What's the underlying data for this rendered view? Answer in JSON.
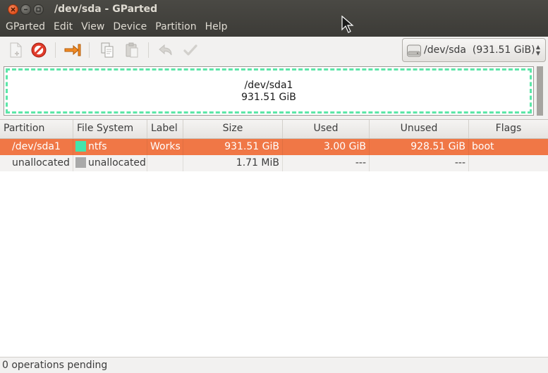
{
  "window": {
    "title": "/dev/sda - GParted"
  },
  "menubar": {
    "items": [
      "GParted",
      "Edit",
      "View",
      "Device",
      "Partition",
      "Help"
    ]
  },
  "toolbar": {
    "buttons": [
      "new-partition-icon",
      "delete-icon",
      "resize-move-icon",
      "copy-icon",
      "paste-icon",
      "undo-icon",
      "apply-icon"
    ],
    "device_selector": "/dev/sda  (931.51 GiB)"
  },
  "graph": {
    "partition_name": "/dev/sda1",
    "partition_size": "931.51 GiB",
    "border_color": "#5ce6a8"
  },
  "table": {
    "columns": [
      "Partition",
      "File System",
      "Label",
      "Size",
      "Used",
      "Unused",
      "Flags"
    ],
    "rows": [
      {
        "partition": "/dev/sda1",
        "filesystem": "ntfs",
        "fs_color": "#42e5ac",
        "label": "Works",
        "size": "931.51 GiB",
        "used": "3.00 GiB",
        "unused": "928.51 GiB",
        "flags": "boot",
        "selected": true
      },
      {
        "partition": "unallocated",
        "filesystem": "unallocated",
        "fs_color": "#a9a9a9",
        "label": "",
        "size": "1.71 MiB",
        "used": "---",
        "unused": "---",
        "flags": "",
        "selected": false
      }
    ],
    "selection_color": "#f07746"
  },
  "statusbar": {
    "text": "0 operations pending"
  }
}
